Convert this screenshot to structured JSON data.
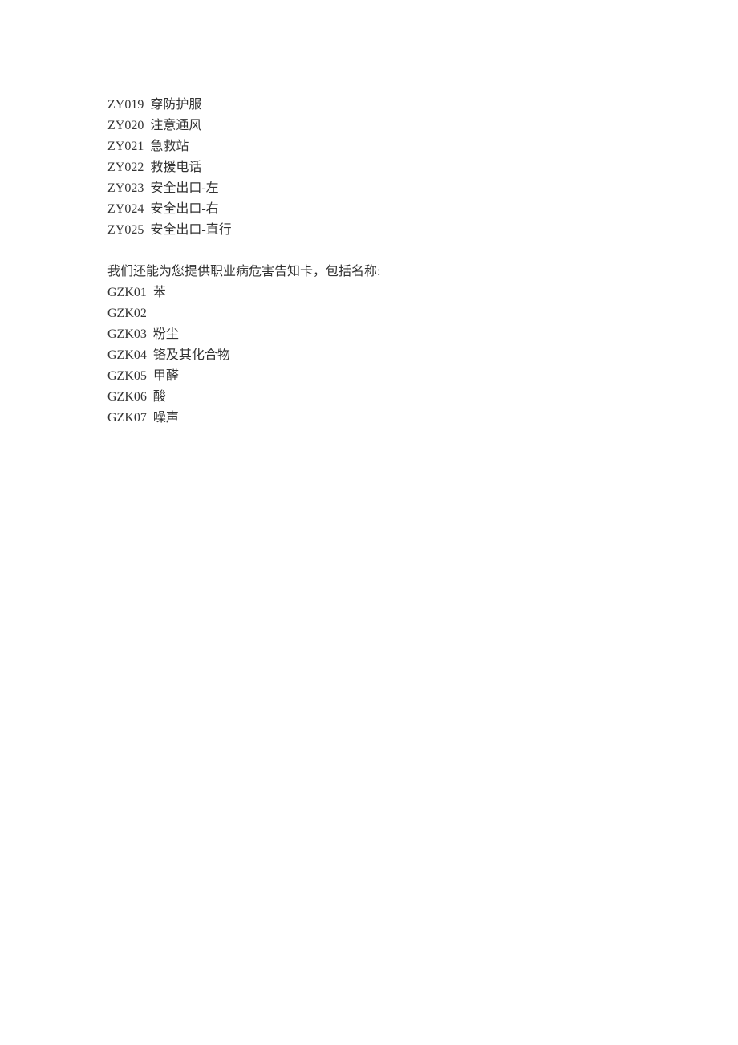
{
  "zy_items": [
    {
      "code": "ZY019",
      "label": "穿防护服"
    },
    {
      "code": "ZY020",
      "label": "注意通风"
    },
    {
      "code": "ZY021",
      "label": "急救站"
    },
    {
      "code": "ZY022",
      "label": "救援电话"
    },
    {
      "code": "ZY023",
      "label": "安全出口-左"
    },
    {
      "code": "ZY024",
      "label": "安全出口-右"
    },
    {
      "code": "ZY025",
      "label": "安全出口-直行"
    }
  ],
  "intro_text": "我们还能为您提供职业病危害告知卡，包括名称:",
  "gzk_items": [
    {
      "code": "GZK01",
      "label": "苯"
    },
    {
      "code": "GZK02",
      "label": ""
    },
    {
      "code": "GZK03",
      "label": "粉尘"
    },
    {
      "code": "GZK04",
      "label": "铬及其化合物"
    },
    {
      "code": "GZK05",
      "label": "甲醛"
    },
    {
      "code": "GZK06",
      "label": "酸"
    },
    {
      "code": "GZK07",
      "label": "噪声"
    }
  ]
}
